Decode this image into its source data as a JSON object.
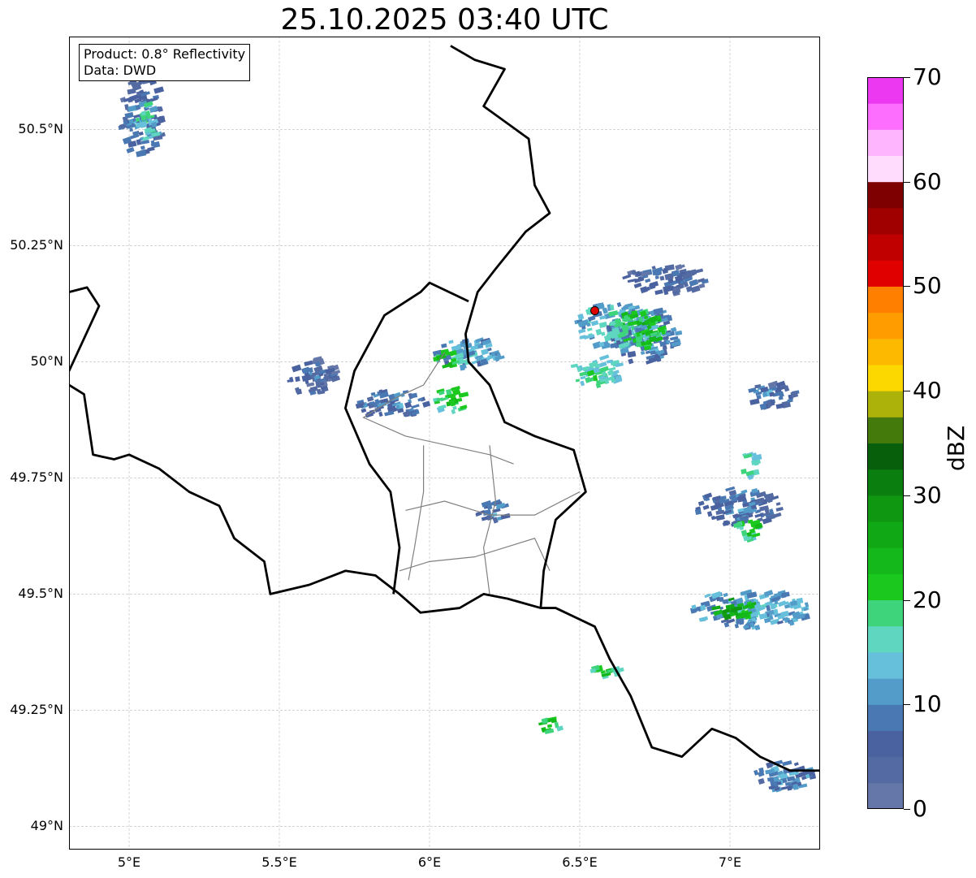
{
  "title": "25.10.2025 03:40 UTC",
  "info_box": {
    "product": "Product: 0.8° Reflectivity",
    "source": "Data: DWD"
  },
  "map": {
    "lon_range": [
      4.8,
      7.3
    ],
    "lat_range": [
      48.95,
      50.7
    ],
    "lat_ticks": [
      {
        "value": 49.0,
        "label": "49°N"
      },
      {
        "value": 49.25,
        "label": "49.25°N"
      },
      {
        "value": 49.5,
        "label": "49.5°N"
      },
      {
        "value": 49.75,
        "label": "49.75°N"
      },
      {
        "value": 50.0,
        "label": "50°N"
      },
      {
        "value": 50.25,
        "label": "50.25°N"
      },
      {
        "value": 50.5,
        "label": "50.5°N"
      }
    ],
    "lon_ticks": [
      {
        "value": 5.0,
        "label": "5°E"
      },
      {
        "value": 5.5,
        "label": "5.5°E"
      },
      {
        "value": 6.0,
        "label": "6°E"
      },
      {
        "value": 6.5,
        "label": "6.5°E"
      },
      {
        "value": 7.0,
        "label": "7°E"
      }
    ],
    "grid": true,
    "radar_site": {
      "lon": 6.55,
      "lat": 50.11,
      "color": "#e00000"
    },
    "borders": {
      "country_color": "#000000",
      "district_color": "#808080"
    },
    "echoes": [
      {
        "lon": 5.03,
        "lat": 50.53,
        "rlon": 0.07,
        "rlat": 0.09,
        "dbz": 10
      },
      {
        "lon": 5.05,
        "lat": 50.52,
        "rlon": 0.03,
        "rlat": 0.05,
        "dbz": 18
      },
      {
        "lon": 5.6,
        "lat": 49.97,
        "rlon": 0.08,
        "rlat": 0.04,
        "dbz": 8
      },
      {
        "lon": 5.86,
        "lat": 49.91,
        "rlon": 0.12,
        "rlat": 0.03,
        "dbz": 10
      },
      {
        "lon": 6.06,
        "lat": 49.92,
        "rlon": 0.05,
        "rlat": 0.03,
        "dbz": 22
      },
      {
        "lon": 6.12,
        "lat": 50.02,
        "rlon": 0.11,
        "rlat": 0.03,
        "dbz": 14
      },
      {
        "lon": 6.05,
        "lat": 50.01,
        "rlon": 0.04,
        "rlat": 0.02,
        "dbz": 24
      },
      {
        "lon": 6.6,
        "lat": 50.08,
        "rlon": 0.12,
        "rlat": 0.05,
        "dbz": 16
      },
      {
        "lon": 6.7,
        "lat": 50.06,
        "rlon": 0.12,
        "rlat": 0.06,
        "dbz": 12
      },
      {
        "lon": 6.68,
        "lat": 50.07,
        "rlon": 0.1,
        "rlat": 0.04,
        "dbz": 24
      },
      {
        "lon": 6.55,
        "lat": 49.98,
        "rlon": 0.09,
        "rlat": 0.03,
        "dbz": 18
      },
      {
        "lon": 6.78,
        "lat": 50.18,
        "rlon": 0.14,
        "rlat": 0.03,
        "dbz": 8
      },
      {
        "lon": 7.02,
        "lat": 49.69,
        "rlon": 0.14,
        "rlat": 0.04,
        "dbz": 10
      },
      {
        "lon": 7.05,
        "lat": 49.64,
        "rlon": 0.05,
        "rlat": 0.02,
        "dbz": 22
      },
      {
        "lon": 7.06,
        "lat": 49.47,
        "rlon": 0.2,
        "rlat": 0.04,
        "dbz": 14
      },
      {
        "lon": 7.0,
        "lat": 49.47,
        "rlon": 0.07,
        "rlat": 0.02,
        "dbz": 28
      },
      {
        "lon": 7.13,
        "lat": 49.93,
        "rlon": 0.08,
        "rlat": 0.025,
        "dbz": 10
      },
      {
        "lon": 7.06,
        "lat": 49.78,
        "rlon": 0.03,
        "rlat": 0.03,
        "dbz": 20
      },
      {
        "lon": 6.58,
        "lat": 49.34,
        "rlon": 0.05,
        "rlat": 0.015,
        "dbz": 22
      },
      {
        "lon": 6.39,
        "lat": 49.22,
        "rlon": 0.04,
        "rlat": 0.015,
        "dbz": 24
      },
      {
        "lon": 7.17,
        "lat": 49.11,
        "rlon": 0.1,
        "rlat": 0.03,
        "dbz": 12
      },
      {
        "lon": 6.2,
        "lat": 49.68,
        "rlon": 0.06,
        "rlat": 0.02,
        "dbz": 10
      }
    ]
  },
  "colorbar": {
    "label": "dBZ",
    "min": 0,
    "max": 70,
    "tick_labels": [
      "0",
      "10",
      "20",
      "30",
      "40",
      "50",
      "60",
      "70"
    ],
    "bins": [
      "#6477a8",
      "#536aa2",
      "#4a63a0",
      "#4a78b2",
      "#539bc8",
      "#66c0db",
      "#5fd6c0",
      "#3dd47c",
      "#1ac81e",
      "#14b81a",
      "#11a815",
      "#0f9712",
      "#0b7e10",
      "#085f0b",
      "#447a0b",
      "#adb20a",
      "#fdd700",
      "#fdb800",
      "#ff9c00",
      "#ff7f00",
      "#e00000",
      "#c00000",
      "#a00000",
      "#7e0000",
      "#ffdcfe",
      "#ffb4fe",
      "#fd6dfe",
      "#ec38f0"
    ]
  }
}
